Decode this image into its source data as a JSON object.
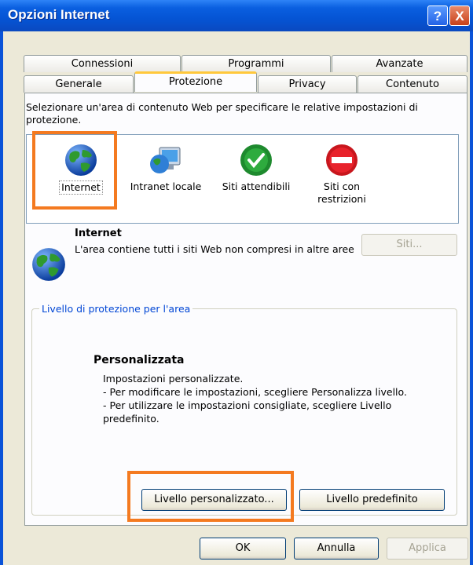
{
  "window": {
    "title": "Opzioni Internet",
    "help_label": "?",
    "close_label": "X"
  },
  "tabs_row1": [
    "Connessioni",
    "Programmi",
    "Avanzate"
  ],
  "tabs_row2": [
    "Generale",
    "Protezione",
    "Privacy",
    "Contenuto"
  ],
  "active_tab": "Protezione",
  "instruction": "Selezionare un'area di contenuto Web per specificare le relative impostazioni di protezione.",
  "zones": [
    {
      "label": "Internet",
      "icon": "globe-icon",
      "selected": true
    },
    {
      "label": "Intranet locale",
      "icon": "intranet-icon"
    },
    {
      "label": "Siti attendibili",
      "icon": "trusted-check-icon"
    },
    {
      "label": "Siti con restrizioni",
      "icon": "restricted-icon"
    }
  ],
  "zone_info": {
    "title": "Internet",
    "description": "L'area contiene tutti i siti Web non compresi in altre aree",
    "sites_button": "Siti..."
  },
  "security_level": {
    "group_label": "Livello di protezione per l'area",
    "title": "Personalizzata",
    "lines": [
      "Impostazioni personalizzate.",
      "- Per modificare le impostazioni, scegliere Personalizza livello.",
      "- Per utilizzare le impostazioni consigliate, scegliere Livello",
      "predefinito."
    ],
    "custom_button": "Livello personalizzato...",
    "default_button": "Livello predefinito"
  },
  "footer": {
    "ok": "OK",
    "cancel": "Annulla",
    "apply": "Applica"
  },
  "colors": {
    "titlebar": "#0554d4",
    "highlight": "#f47a20",
    "tab_active_top": "#ffc83c",
    "group_label": "#0046d5"
  }
}
